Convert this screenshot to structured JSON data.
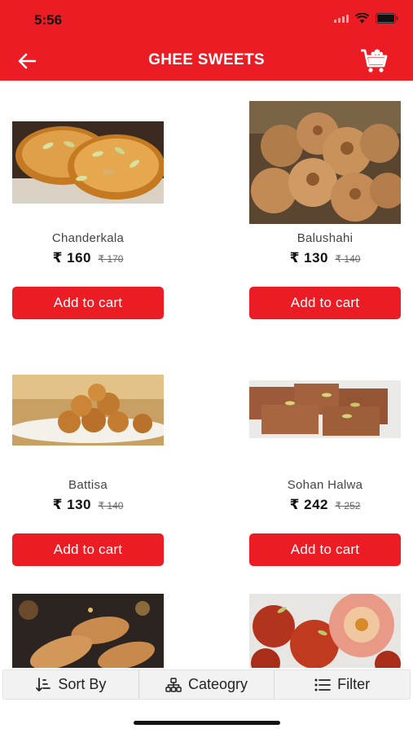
{
  "status_bar": {
    "time": "5:56"
  },
  "header": {
    "title": "GHEE SWEETS"
  },
  "products": [
    {
      "name": "Chanderkala",
      "price": "₹ 160",
      "mrp": "₹ 170",
      "button": "Add to cart",
      "image": "chanderkala-photo"
    },
    {
      "name": "Balushahi",
      "price": "₹ 130",
      "mrp": "₹ 140",
      "button": "Add to cart",
      "image": "balushahi-photo"
    },
    {
      "name": "Battisa",
      "price": "₹ 130",
      "mrp": "₹ 140",
      "button": "Add to cart",
      "image": "battisa-photo"
    },
    {
      "name": "Sohan Halwa",
      "price": "₹ 242",
      "mrp": "₹ 252",
      "button": "Add to cart",
      "image": "sohan-halwa-photo"
    },
    {
      "image": "gujiya-photo"
    },
    {
      "image": "gulab-jamun-photo"
    }
  ],
  "bottom_bar": {
    "sort": "Sort By",
    "category": "Cateogry",
    "filter": "Filter"
  },
  "colors": {
    "brand": "#ec1c24",
    "bar": "#f2f2f2"
  }
}
